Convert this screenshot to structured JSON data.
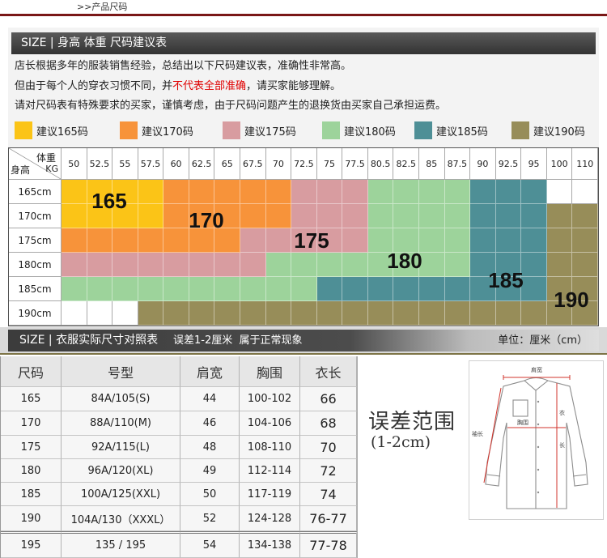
{
  "page_header": {
    "title": ">>产品尺码"
  },
  "recommend": {
    "banner": "SIZE | 身高 体重 尺码建议表",
    "notes": {
      "line1": "店长根据多年的服装销售经验，总结出以下尺码建议表，准确性非常高。",
      "line2_before": "但由于每个人的穿衣习惯不同，并",
      "line2_highlight": "不代表全部准确",
      "line2_after": "，请买家能够理解。",
      "line3": "请对尺码表有特殊要求的买家，谨慎考虑，由于尺码问题产生的退换货由买家自己承担运费。",
      "highlight_color": "#e00000"
    }
  },
  "legend": [
    {
      "size": "165",
      "label": "建议165码",
      "color": "#fbc417"
    },
    {
      "size": "170",
      "label": "建议170码",
      "color": "#f7933a"
    },
    {
      "size": "175",
      "label": "建议175码",
      "color": "#d89ca0"
    },
    {
      "size": "180",
      "label": "建议180码",
      "color": "#9dd39b"
    },
    {
      "size": "185",
      "label": "建议185码",
      "color": "#4e8f96"
    },
    {
      "size": "190",
      "label": "建议190码",
      "color": "#978d59"
    }
  ],
  "grid": {
    "corner": {
      "weight": "体重",
      "unit": "KG",
      "height": "身高"
    },
    "weights": [
      "50",
      "52.5",
      "55",
      "57.5",
      "60",
      "62.5",
      "65",
      "67.5",
      "70",
      "72.5",
      "75",
      "77.5",
      "80.5",
      "82.5",
      "85",
      "87.5",
      "90",
      "92.5",
      "95",
      "100",
      "110"
    ],
    "rows": [
      {
        "height": "165cm",
        "sizes": [
          "165",
          "165",
          "165",
          "165",
          "170",
          "170",
          "170",
          "170",
          "170",
          "175",
          "175",
          "175",
          "180",
          "180",
          "180",
          "180",
          "185",
          "185",
          "185",
          null,
          null
        ]
      },
      {
        "height": "170cm",
        "sizes": [
          "165",
          "165",
          "165",
          "165",
          "170",
          "170",
          "170",
          "170",
          "170",
          "175",
          "175",
          "175",
          "180",
          "180",
          "180",
          "180",
          "185",
          "185",
          "185",
          "190",
          "190"
        ]
      },
      {
        "height": "175cm",
        "sizes": [
          "170",
          "170",
          "170",
          "170",
          "170",
          "170",
          "170",
          "175",
          "175",
          "175",
          "175",
          "175",
          "180",
          "180",
          "180",
          "180",
          "185",
          "185",
          "185",
          "190",
          "190"
        ]
      },
      {
        "height": "180cm",
        "sizes": [
          "175",
          "175",
          "175",
          "175",
          "175",
          "175",
          "175",
          "175",
          "180",
          "180",
          "180",
          "180",
          "180",
          "180",
          "180",
          "180",
          "185",
          "185",
          "185",
          "190",
          "190"
        ]
      },
      {
        "height": "185cm",
        "sizes": [
          "180",
          "180",
          "180",
          "180",
          "180",
          "180",
          "180",
          "180",
          "180",
          "180",
          "185",
          "185",
          "185",
          "185",
          "185",
          "185",
          "185",
          "185",
          "185",
          "190",
          "190"
        ]
      },
      {
        "height": "190cm",
        "sizes": [
          null,
          null,
          null,
          "190",
          "190",
          "190",
          "190",
          "190",
          "190",
          "190",
          "190",
          "190",
          "190",
          "190",
          "190",
          "190",
          "190",
          "190",
          "190",
          "190",
          "190"
        ]
      }
    ]
  },
  "actual_size": {
    "banner_title": "SIZE | 衣服实际尺寸对照表",
    "banner_note": "误差1-2厘米  属于正常现象",
    "unit": "单位：厘米（cm）",
    "headers": [
      "尺码",
      "号型",
      "肩宽",
      "胸围",
      "衣长"
    ],
    "rows": [
      [
        "165",
        "84A/105(S)",
        "44",
        "100-102",
        "66"
      ],
      [
        "170",
        "88A/110(M)",
        "46",
        "104-106",
        "68"
      ],
      [
        "175",
        "92A/115(L)",
        "48",
        "108-110",
        "70"
      ],
      [
        "180",
        "96A/120(XL)",
        "49",
        "112-114",
        "72"
      ],
      [
        "185",
        "100A/125(XXL)",
        "50",
        "117-119",
        "74"
      ],
      [
        "190",
        "104A/130（XXXL）",
        "52",
        "124-128",
        "76-77"
      ],
      [
        "195",
        "135 / 195",
        "54",
        "134-138",
        "77-78"
      ]
    ]
  },
  "error_range": {
    "title": "误差范围",
    "range": "(1-2cm)"
  },
  "diagram_labels": {
    "shoulder": "肩宽",
    "chest": "胸围",
    "length_top": "衣",
    "length_bottom": "长",
    "sleeve": "袖长"
  }
}
